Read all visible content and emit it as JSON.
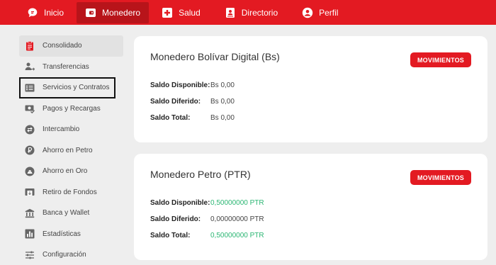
{
  "topnav": {
    "items": [
      {
        "label": "Inicio",
        "icon": "chat-bubble-icon"
      },
      {
        "label": "Monedero",
        "icon": "wallet-icon",
        "active": true
      },
      {
        "label": "Salud",
        "icon": "medical-cross-icon"
      },
      {
        "label": "Directorio",
        "icon": "contact-card-icon"
      },
      {
        "label": "Perfil",
        "icon": "account-circle-icon"
      }
    ]
  },
  "sidebar": {
    "items": [
      {
        "label": "Consolidado",
        "icon": "clipboard-icon",
        "active": true
      },
      {
        "label": "Transferencias",
        "icon": "person-transfer-icon"
      },
      {
        "label": "Servicios y Contratos",
        "icon": "list-icon"
      },
      {
        "label": "Pagos y Recargas",
        "icon": "money-check-icon"
      },
      {
        "label": "Intercambio",
        "icon": "swap-icon"
      },
      {
        "label": "Ahorro en Petro",
        "icon": "petro-coin-icon"
      },
      {
        "label": "Ahorro en Oro",
        "icon": "gold-bars-icon"
      },
      {
        "label": "Retiro de Fondos",
        "icon": "withdraw-icon"
      },
      {
        "label": "Banca y Wallet",
        "icon": "bank-icon"
      },
      {
        "label": "Estadísticas",
        "icon": "bar-chart-icon"
      },
      {
        "label": "Configuración",
        "icon": "sliders-icon"
      }
    ]
  },
  "wallets": [
    {
      "title": "Monedero Bolívar Digital (Bs)",
      "button": "MOVIMIENTOS",
      "rows": [
        {
          "label": "Saldo Disponible:",
          "value": "Bs 0,00"
        },
        {
          "label": "Saldo Diferido:",
          "value": "Bs 0,00"
        },
        {
          "label": "Saldo Total:",
          "value": "Bs 0,00"
        }
      ]
    },
    {
      "title": "Monedero Petro (PTR)",
      "button": "MOVIMIENTOS",
      "rows": [
        {
          "label": "Saldo Disponible:",
          "value": "0,50000000 PTR"
        },
        {
          "label": "Saldo Diferido:",
          "value": "0,00000000 PTR"
        },
        {
          "label": "Saldo Total:",
          "value": "0,50000000 PTR"
        }
      ]
    }
  ],
  "colors": {
    "brand_red": "#e31a22",
    "positive_green": "#2bb673"
  }
}
